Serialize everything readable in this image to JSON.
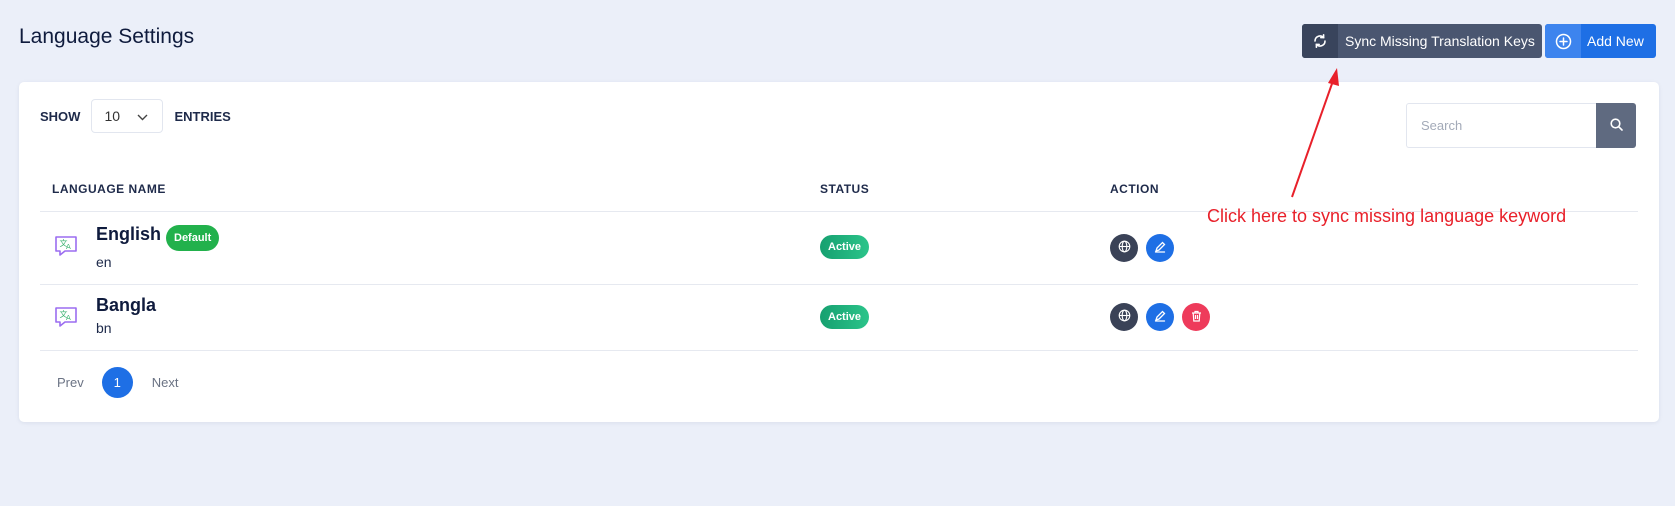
{
  "header": {
    "title": "Language Settings",
    "sync_button_label": "Sync Missing Translation Keys",
    "add_button_label": "Add New"
  },
  "controls": {
    "show_label": "SHOW",
    "entries_value": "10",
    "entries_label": "ENTRIES",
    "search_placeholder": "Search"
  },
  "table": {
    "columns": [
      "LANGUAGE NAME",
      "STATUS",
      "ACTION"
    ],
    "rows": [
      {
        "name": "English",
        "code": "en",
        "badge": "Default",
        "status": "Active"
      },
      {
        "name": "Bangla",
        "code": "bn",
        "status": "Active"
      }
    ]
  },
  "pagination": {
    "prev": "Prev",
    "page": "1",
    "next": "Next"
  },
  "annotation": {
    "text": "Click here to sync missing language keyword"
  },
  "colors": {
    "background": "#ebeff9",
    "primary": "#1e6fe5",
    "sync_button": "#4a5670",
    "success": "#22b14c",
    "danger": "#ee3b5b",
    "annotation": "#e8202a"
  },
  "icons": {
    "sync": "refresh-icon",
    "add": "plus-circle-icon",
    "search": "search-icon",
    "language": "translate-icon",
    "translate_action": "globe-icon",
    "edit": "pencil-icon",
    "delete": "trash-icon"
  }
}
